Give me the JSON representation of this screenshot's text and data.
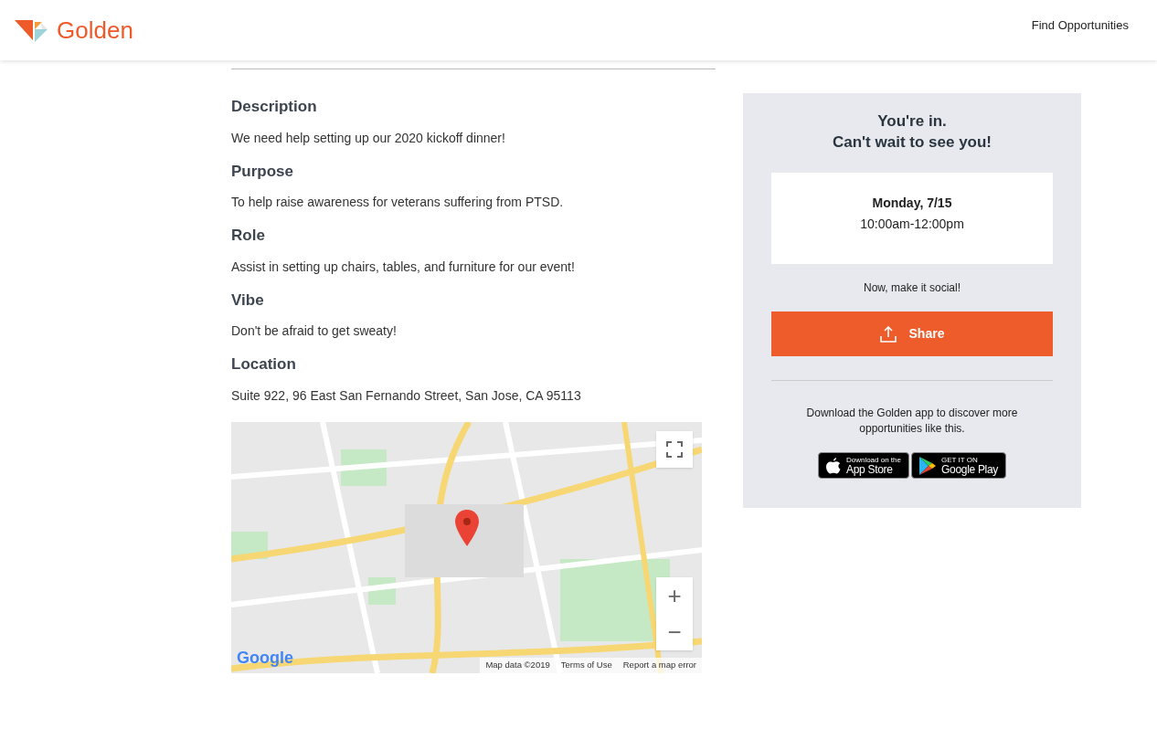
{
  "header": {
    "brand": "Golden",
    "nav": [
      {
        "label": "Find Opportunities"
      }
    ]
  },
  "details": [
    {
      "heading": "Description",
      "text": "We need help setting up our 2020 kickoff dinner!"
    },
    {
      "heading": "Purpose",
      "text": "To help raise awareness for veterans suffering from PTSD."
    },
    {
      "heading": "Role",
      "text": "Assist in setting up chairs, tables, and furniture for our event!"
    },
    {
      "heading": "Vibe",
      "text": "Don't be afraid to get sweaty!"
    },
    {
      "heading": "Location",
      "text": "Suite 922, 96 East San Fernando Street, San Jose, CA 95113"
    }
  ],
  "map": {
    "zoom_in": "+",
    "zoom_out": "−",
    "attribution": "Google",
    "footer": [
      "Map data ©2019",
      "Terms of Use",
      "Report a map error"
    ]
  },
  "confirmation": {
    "title_lines": [
      "You're in.",
      "Can't wait to see you!"
    ],
    "date": "Monday, 7/15",
    "time": "10:00am-12:00pm",
    "social_prompt": "Now, make it social!",
    "share_button": "Share",
    "download_text": "Download the Golden app to discover more opportunities like this.",
    "badges": [
      {
        "kind": "apple",
        "small": "Download on the",
        "large": "App Store"
      },
      {
        "kind": "google",
        "small": "GET IT ON",
        "large": "Google Play"
      }
    ]
  }
}
